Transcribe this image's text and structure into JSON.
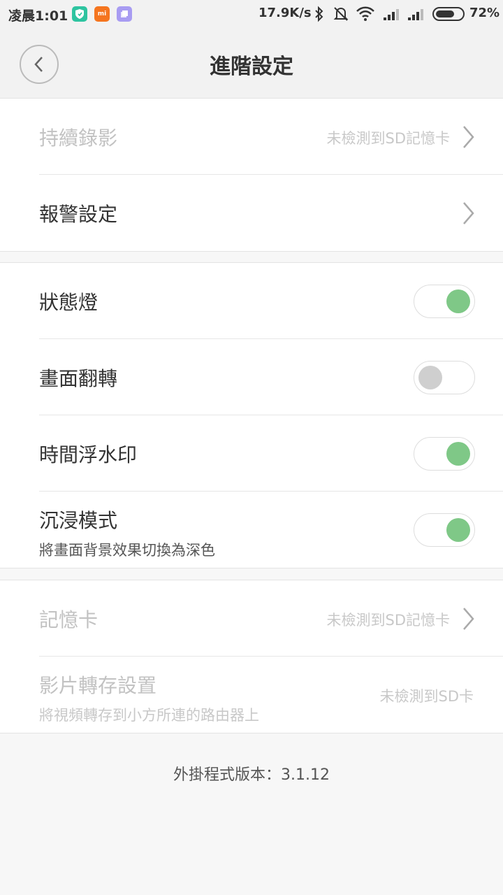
{
  "status_bar": {
    "time": "凌晨1:01",
    "app_icons": [
      "shield-icon",
      "mi-icon",
      "cube-icon"
    ],
    "mi_label": "mi",
    "net_speed": "17.9K/s",
    "icons": [
      "bluetooth-icon",
      "mute-icon",
      "wifi-icon",
      "signal-icon",
      "signal-icon"
    ],
    "battery_pct": "72%",
    "battery_level": 0.72
  },
  "header": {
    "title": "進階設定"
  },
  "group1": {
    "items": [
      {
        "label": "持續錄影",
        "value": "未檢測到SD記憶卡"
      },
      {
        "label": "報警設定"
      }
    ]
  },
  "group2": {
    "items": [
      {
        "label": "狀態燈",
        "on": true
      },
      {
        "label": "畫面翻轉",
        "on": false
      },
      {
        "label": "時間浮水印",
        "on": true
      },
      {
        "label": "沉浸模式",
        "sub": "將畫面背景效果切換為深色",
        "on": true
      }
    ]
  },
  "group3": {
    "items": [
      {
        "label": "記憶卡",
        "value": "未檢測到SD記憶卡"
      },
      {
        "label": "影片轉存設置",
        "sub": "將視頻轉存到小方所連的路由器上",
        "value": "未檢測到SD卡"
      }
    ]
  },
  "footer": {
    "version": "外掛程式版本：3.1.12"
  },
  "colors": {
    "toggle_on": "#7fc887",
    "toggle_off": "#cfcfcf",
    "background": "#f7f7f7"
  }
}
